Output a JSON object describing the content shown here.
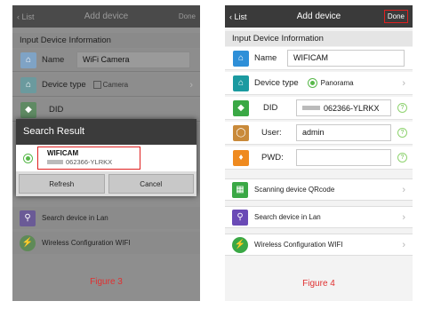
{
  "figure3": {
    "nav": {
      "back": "List",
      "title": "Add device",
      "done": "Done"
    },
    "section": "Input Device Information",
    "name": {
      "label": "Name",
      "value": "WiFi Camera"
    },
    "device_type": {
      "label": "Device type",
      "value": "Camera"
    },
    "did": {
      "label": "DID"
    },
    "dialog": {
      "title": "Search Result",
      "device_name": "WIFICAM",
      "device_id": "062366-YLRKX",
      "refresh": "Refresh",
      "cancel": "Cancel"
    },
    "search_lan": "Search device in Lan",
    "wireless_config": "Wireless Configuration WIFI",
    "caption": "Figure 3"
  },
  "figure4": {
    "nav": {
      "back": "List",
      "title": "Add device",
      "done": "Done"
    },
    "section": "Input Device Information",
    "name": {
      "label": "Name",
      "value": "WIFICAM"
    },
    "device_type": {
      "label": "Device type",
      "value": "Panorama"
    },
    "did": {
      "label": "DID",
      "value": "062366-YLRKX"
    },
    "user": {
      "label": "User:",
      "value": "admin"
    },
    "pwd": {
      "label": "PWD:",
      "value": ""
    },
    "scan_qr": "Scanning device QRcode",
    "search_lan": "Search device in Lan",
    "wireless_config": "Wireless Configuration WIFI",
    "caption": "Figure 4",
    "help_glyph": "?"
  },
  "colors": {
    "accent_blue": "#2e8fd8",
    "teal": "#1b9aa0",
    "green": "#3aa845",
    "orange": "#ef8a1f",
    "purple": "#6a4ab6",
    "red": "#e02020"
  }
}
